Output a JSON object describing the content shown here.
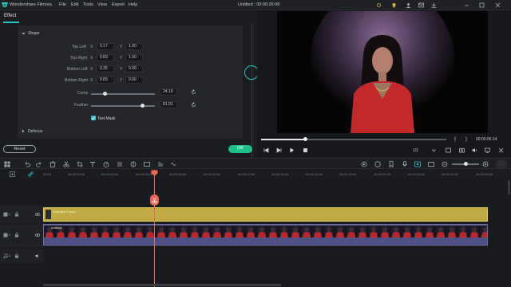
{
  "app": {
    "name": "Wondershare Filmora",
    "title": "Untitled : 00:00:26:06"
  },
  "menu": [
    "File",
    "Edit",
    "Tools",
    "View",
    "Export",
    "Help"
  ],
  "tabs": {
    "effect": "Effect"
  },
  "shape": {
    "section_label": "Shape",
    "rows": [
      {
        "label": "Top Left",
        "x": "0.17",
        "y": "1.00"
      },
      {
        "label": "Top Right",
        "x": "0.83",
        "y": "1.00"
      },
      {
        "label": "Bottom Left",
        "x": "0.35",
        "y": "0.00"
      },
      {
        "label": "Bottom Right",
        "x": "0.65",
        "y": "0.00"
      }
    ],
    "axis_x": "X",
    "axis_y": "Y",
    "curve": {
      "label": "Curve",
      "value": "24.19",
      "level": 0.22
    },
    "feather": {
      "label": "Feather",
      "value": "81.01",
      "level": 0.81
    },
    "test_mask": {
      "label": "Test Mask",
      "checked": true
    },
    "defocus_label": "Defocus"
  },
  "buttons": {
    "reset": "Reset",
    "ok": "OK"
  },
  "player": {
    "time": "00:00:06:14",
    "progress": 0.24,
    "quality": "1/2",
    "bracket_left": "{",
    "bracket_right": "}"
  },
  "ruler": [
    "00:00",
    "00:00:02:00",
    "00:00:04:00",
    "00:00:06:00",
    "00:00:08:00",
    "00:00:10:00",
    "00:00:12:00",
    "00:00:14:00",
    "00:00:16:00",
    "00:00:18:00",
    "00:00:20:00",
    "00:00:22:00",
    "00:00:24:00",
    "00:00:26:00"
  ],
  "tracks": {
    "track_numbers": [
      "2",
      "1",
      "1"
    ],
    "effect_clip": "Selective Focus",
    "video_clip": "untitled"
  },
  "colors": {
    "accent": "#29c1c8",
    "ok_green": "#1fbf8a",
    "playhead": "#f0685a",
    "effect_clip": "#c9b24a"
  }
}
